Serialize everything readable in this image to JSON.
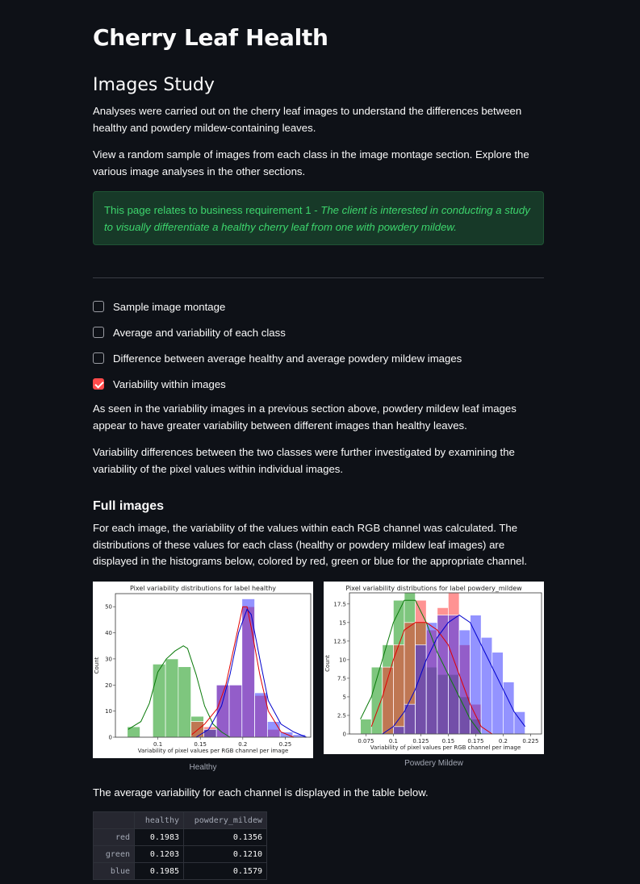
{
  "page": {
    "title": "Cherry Leaf Health",
    "subtitle": "Images Study",
    "intro_1": "Analyses were carried out on the cherry leaf images to understand the differences between healthy and powdery mildew-containing leaves.",
    "intro_2": "View a random sample of images from each class in the image montage section. Explore the various image analyses in the other sections.",
    "info_prefix": "This page relates to business requirement 1 - ",
    "info_emphasis": "The client is interested in conducting a study to visually differentiate a healthy cherry leaf from one with powdery mildew."
  },
  "checkboxes": [
    {
      "label": "Sample image montage",
      "checked": false
    },
    {
      "label": "Average and variability of each class",
      "checked": false
    },
    {
      "label": "Difference between average healthy and average powdery mildew images",
      "checked": false
    },
    {
      "label": "Variability within images",
      "checked": true
    }
  ],
  "section": {
    "para_1": "As seen in the variability images in a previous section above, powdery mildew leaf images appear to have greater variability between different images than healthy leaves.",
    "para_2": "Variability differences between the two classes were further investigated by examining the variability of the pixel values within individual images.",
    "heading": "Full images",
    "para_3": "For each image, the variability of the values within each RGB channel was calculated. The distributions of these values for each class (healthy or powdery mildew leaf images) are displayed in the histograms below, colored by red, green or blue for the appropriate channel.",
    "caption_left": "Healthy",
    "caption_right": "Powdery Mildew",
    "table_intro": "The average variability for each channel is displayed in the table below."
  },
  "table": {
    "columns": [
      "",
      "healthy",
      "powdery_mildew"
    ],
    "rows": [
      {
        "label": "red",
        "healthy": "0.1983",
        "powdery_mildew": "0.1356"
      },
      {
        "label": "green",
        "healthy": "0.1203",
        "powdery_mildew": "0.1210"
      },
      {
        "label": "blue",
        "healthy": "0.1985",
        "powdery_mildew": "0.1579"
      }
    ]
  },
  "colors": {
    "info_text": "#3dd56d",
    "checkbox_checked": "#ff4b4b",
    "red": "#ff3030",
    "green": "#3aa63a",
    "blue": "#3030ff"
  },
  "chart_data": [
    {
      "type": "bar",
      "title": "Pixel variability distributions for label healthy",
      "xlabel": "Variability of pixel values per RGB channel per image",
      "ylabel": "Count",
      "xlim": [
        0.05,
        0.28
      ],
      "ylim": [
        0,
        55
      ],
      "xticks": [
        0.1,
        0.15,
        0.2,
        0.25
      ],
      "yticks": [
        0,
        10,
        20,
        30,
        40,
        50
      ],
      "series": [
        {
          "color": "green",
          "bins": [
            [
              0.064,
              0.079,
              4
            ],
            [
              0.079,
              0.094,
              0
            ],
            [
              0.094,
              0.109,
              28
            ],
            [
              0.109,
              0.124,
              30
            ],
            [
              0.124,
              0.139,
              27
            ],
            [
              0.139,
              0.154,
              8
            ],
            [
              0.154,
              0.169,
              3
            ]
          ],
          "kde": [
            [
              0.065,
              3
            ],
            [
              0.08,
              6
            ],
            [
              0.09,
              13
            ],
            [
              0.1,
              25
            ],
            [
              0.11,
              30
            ],
            [
              0.12,
              33
            ],
            [
              0.13,
              35
            ],
            [
              0.135,
              34
            ],
            [
              0.145,
              24
            ],
            [
              0.155,
              12
            ],
            [
              0.165,
              5
            ],
            [
              0.175,
              2
            ],
            [
              0.185,
              0
            ]
          ]
        },
        {
          "color": "red",
          "bins": [
            [
              0.139,
              0.154,
              6
            ],
            [
              0.154,
              0.169,
              4
            ],
            [
              0.169,
              0.184,
              20
            ],
            [
              0.184,
              0.199,
              20
            ],
            [
              0.199,
              0.214,
              50
            ],
            [
              0.214,
              0.229,
              16
            ],
            [
              0.229,
              0.244,
              3
            ]
          ],
          "kde": [
            [
              0.14,
              1
            ],
            [
              0.155,
              5
            ],
            [
              0.17,
              11
            ],
            [
              0.18,
              20
            ],
            [
              0.19,
              35
            ],
            [
              0.2,
              50
            ],
            [
              0.205,
              50
            ],
            [
              0.21,
              42
            ],
            [
              0.22,
              24
            ],
            [
              0.23,
              10
            ],
            [
              0.245,
              2
            ],
            [
              0.26,
              0
            ]
          ]
        },
        {
          "color": "blue",
          "bins": [
            [
              0.154,
              0.169,
              3
            ],
            [
              0.169,
              0.184,
              20
            ],
            [
              0.184,
              0.199,
              20
            ],
            [
              0.199,
              0.214,
              53
            ],
            [
              0.214,
              0.229,
              17
            ],
            [
              0.229,
              0.244,
              6
            ],
            [
              0.244,
              0.259,
              2
            ],
            [
              0.259,
              0.274,
              1
            ]
          ],
          "kde": [
            [
              0.145,
              0
            ],
            [
              0.16,
              3
            ],
            [
              0.175,
              12
            ],
            [
              0.185,
              24
            ],
            [
              0.195,
              40
            ],
            [
              0.205,
              49
            ],
            [
              0.21,
              47
            ],
            [
              0.22,
              30
            ],
            [
              0.23,
              14
            ],
            [
              0.245,
              5
            ],
            [
              0.26,
              2
            ],
            [
              0.275,
              0
            ]
          ]
        }
      ]
    },
    {
      "type": "bar",
      "title": "Pixel variability distributions for label powdery_mildew",
      "xlabel": "Variability of pixel values per RGB channel per image",
      "ylabel": "Count",
      "xlim": [
        0.06,
        0.235
      ],
      "ylim": [
        0,
        19
      ],
      "xticks": [
        0.075,
        0.1,
        0.125,
        0.15,
        0.175,
        0.2,
        0.225
      ],
      "yticks": [
        0,
        2.5,
        5,
        7.5,
        10,
        12.5,
        15,
        17.5
      ],
      "series": [
        {
          "color": "green",
          "bins": [
            [
              0.07,
              0.08,
              2
            ],
            [
              0.08,
              0.09,
              9
            ],
            [
              0.09,
              0.1,
              12
            ],
            [
              0.1,
              0.11,
              18
            ],
            [
              0.11,
              0.12,
              19
            ],
            [
              0.12,
              0.13,
              15
            ],
            [
              0.13,
              0.14,
              9
            ],
            [
              0.14,
              0.15,
              8
            ],
            [
              0.15,
              0.16,
              8
            ],
            [
              0.16,
              0.17,
              5
            ],
            [
              0.17,
              0.18,
              2
            ]
          ],
          "kde": [
            [
              0.07,
              2
            ],
            [
              0.08,
              5
            ],
            [
              0.09,
              10
            ],
            [
              0.1,
              15
            ],
            [
              0.11,
              18
            ],
            [
              0.12,
              18
            ],
            [
              0.13,
              15
            ],
            [
              0.14,
              11
            ],
            [
              0.15,
              8
            ],
            [
              0.16,
              5
            ],
            [
              0.17,
              2
            ],
            [
              0.18,
              0
            ]
          ]
        },
        {
          "color": "red",
          "bins": [
            [
              0.09,
              0.1,
              9
            ],
            [
              0.1,
              0.11,
              12
            ],
            [
              0.11,
              0.12,
              15
            ],
            [
              0.12,
              0.13,
              18
            ],
            [
              0.13,
              0.14,
              14
            ],
            [
              0.14,
              0.15,
              17
            ],
            [
              0.15,
              0.16,
              19
            ],
            [
              0.16,
              0.17,
              12
            ],
            [
              0.17,
              0.18,
              4
            ]
          ],
          "kde": [
            [
              0.08,
              1
            ],
            [
              0.09,
              5
            ],
            [
              0.1,
              10
            ],
            [
              0.11,
              14
            ],
            [
              0.12,
              15
            ],
            [
              0.13,
              15
            ],
            [
              0.14,
              14
            ],
            [
              0.15,
              12
            ],
            [
              0.16,
              8
            ],
            [
              0.17,
              4
            ],
            [
              0.18,
              1
            ],
            [
              0.19,
              0
            ]
          ]
        },
        {
          "color": "blue",
          "bins": [
            [
              0.1,
              0.11,
              1
            ],
            [
              0.11,
              0.12,
              4
            ],
            [
              0.12,
              0.13,
              12
            ],
            [
              0.13,
              0.14,
              15
            ],
            [
              0.14,
              0.15,
              16
            ],
            [
              0.15,
              0.16,
              16
            ],
            [
              0.16,
              0.17,
              14
            ],
            [
              0.17,
              0.18,
              16
            ],
            [
              0.18,
              0.19,
              13
            ],
            [
              0.19,
              0.2,
              11
            ],
            [
              0.2,
              0.21,
              7
            ],
            [
              0.21,
              0.22,
              3
            ]
          ],
          "kde": [
            [
              0.09,
              0
            ],
            [
              0.1,
              1
            ],
            [
              0.11,
              3
            ],
            [
              0.12,
              6
            ],
            [
              0.13,
              10
            ],
            [
              0.14,
              13
            ],
            [
              0.15,
              15
            ],
            [
              0.16,
              16
            ],
            [
              0.17,
              15
            ],
            [
              0.18,
              12
            ],
            [
              0.19,
              9
            ],
            [
              0.2,
              6
            ],
            [
              0.21,
              3
            ],
            [
              0.22,
              1
            ]
          ]
        }
      ]
    }
  ]
}
